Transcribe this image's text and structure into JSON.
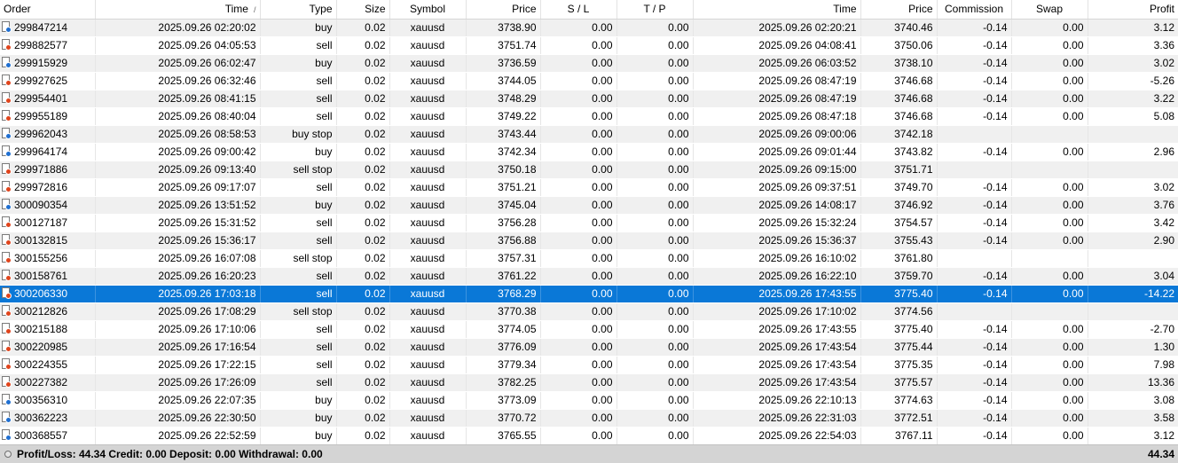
{
  "columns": [
    "Order",
    "Time",
    "Type",
    "Size",
    "Symbol",
    "Price",
    "S / L",
    "T / P",
    "Time",
    "Price",
    "Commission",
    "Swap",
    "Profit"
  ],
  "sort_indicator": "/",
  "colors": {
    "buy": "#1f6fd1",
    "sell": "#e0441c",
    "selected": "#0a78d7"
  },
  "rows": [
    {
      "order": "299847214",
      "open_time": "2025.09.26 02:20:02",
      "type": "buy",
      "size": "0.02",
      "symbol": "xauusd",
      "open_price": "3738.90",
      "sl": "0.00",
      "tp": "0.00",
      "close_time": "2025.09.26 02:20:21",
      "close_price": "3740.46",
      "commission": "-0.14",
      "swap": "0.00",
      "profit": "3.12",
      "icon": "buy"
    },
    {
      "order": "299882577",
      "open_time": "2025.09.26 04:05:53",
      "type": "sell",
      "size": "0.02",
      "symbol": "xauusd",
      "open_price": "3751.74",
      "sl": "0.00",
      "tp": "0.00",
      "close_time": "2025.09.26 04:08:41",
      "close_price": "3750.06",
      "commission": "-0.14",
      "swap": "0.00",
      "profit": "3.36",
      "icon": "sell"
    },
    {
      "order": "299915929",
      "open_time": "2025.09.26 06:02:47",
      "type": "buy",
      "size": "0.02",
      "symbol": "xauusd",
      "open_price": "3736.59",
      "sl": "0.00",
      "tp": "0.00",
      "close_time": "2025.09.26 06:03:52",
      "close_price": "3738.10",
      "commission": "-0.14",
      "swap": "0.00",
      "profit": "3.02",
      "icon": "buy"
    },
    {
      "order": "299927625",
      "open_time": "2025.09.26 06:32:46",
      "type": "sell",
      "size": "0.02",
      "symbol": "xauusd",
      "open_price": "3744.05",
      "sl": "0.00",
      "tp": "0.00",
      "close_time": "2025.09.26 08:47:19",
      "close_price": "3746.68",
      "commission": "-0.14",
      "swap": "0.00",
      "profit": "-5.26",
      "icon": "sell"
    },
    {
      "order": "299954401",
      "open_time": "2025.09.26 08:41:15",
      "type": "sell",
      "size": "0.02",
      "symbol": "xauusd",
      "open_price": "3748.29",
      "sl": "0.00",
      "tp": "0.00",
      "close_time": "2025.09.26 08:47:19",
      "close_price": "3746.68",
      "commission": "-0.14",
      "swap": "0.00",
      "profit": "3.22",
      "icon": "sell"
    },
    {
      "order": "299955189",
      "open_time": "2025.09.26 08:40:04",
      "type": "sell",
      "size": "0.02",
      "symbol": "xauusd",
      "open_price": "3749.22",
      "sl": "0.00",
      "tp": "0.00",
      "close_time": "2025.09.26 08:47:18",
      "close_price": "3746.68",
      "commission": "-0.14",
      "swap": "0.00",
      "profit": "5.08",
      "icon": "sell"
    },
    {
      "order": "299962043",
      "open_time": "2025.09.26 08:58:53",
      "type": "buy stop",
      "size": "0.02",
      "symbol": "xauusd",
      "open_price": "3743.44",
      "sl": "0.00",
      "tp": "0.00",
      "close_time": "2025.09.26 09:00:06",
      "close_price": "3742.18",
      "commission": "",
      "swap": "",
      "profit": "",
      "icon": "buy"
    },
    {
      "order": "299964174",
      "open_time": "2025.09.26 09:00:42",
      "type": "buy",
      "size": "0.02",
      "symbol": "xauusd",
      "open_price": "3742.34",
      "sl": "0.00",
      "tp": "0.00",
      "close_time": "2025.09.26 09:01:44",
      "close_price": "3743.82",
      "commission": "-0.14",
      "swap": "0.00",
      "profit": "2.96",
      "icon": "buy"
    },
    {
      "order": "299971886",
      "open_time": "2025.09.26 09:13:40",
      "type": "sell stop",
      "size": "0.02",
      "symbol": "xauusd",
      "open_price": "3750.18",
      "sl": "0.00",
      "tp": "0.00",
      "close_time": "2025.09.26 09:15:00",
      "close_price": "3751.71",
      "commission": "",
      "swap": "",
      "profit": "",
      "icon": "sell"
    },
    {
      "order": "299972816",
      "open_time": "2025.09.26 09:17:07",
      "type": "sell",
      "size": "0.02",
      "symbol": "xauusd",
      "open_price": "3751.21",
      "sl": "0.00",
      "tp": "0.00",
      "close_time": "2025.09.26 09:37:51",
      "close_price": "3749.70",
      "commission": "-0.14",
      "swap": "0.00",
      "profit": "3.02",
      "icon": "sell"
    },
    {
      "order": "300090354",
      "open_time": "2025.09.26 13:51:52",
      "type": "buy",
      "size": "0.02",
      "symbol": "xauusd",
      "open_price": "3745.04",
      "sl": "0.00",
      "tp": "0.00",
      "close_time": "2025.09.26 14:08:17",
      "close_price": "3746.92",
      "commission": "-0.14",
      "swap": "0.00",
      "profit": "3.76",
      "icon": "buy"
    },
    {
      "order": "300127187",
      "open_time": "2025.09.26 15:31:52",
      "type": "sell",
      "size": "0.02",
      "symbol": "xauusd",
      "open_price": "3756.28",
      "sl": "0.00",
      "tp": "0.00",
      "close_time": "2025.09.26 15:32:24",
      "close_price": "3754.57",
      "commission": "-0.14",
      "swap": "0.00",
      "profit": "3.42",
      "icon": "sell"
    },
    {
      "order": "300132815",
      "open_time": "2025.09.26 15:36:17",
      "type": "sell",
      "size": "0.02",
      "symbol": "xauusd",
      "open_price": "3756.88",
      "sl": "0.00",
      "tp": "0.00",
      "close_time": "2025.09.26 15:36:37",
      "close_price": "3755.43",
      "commission": "-0.14",
      "swap": "0.00",
      "profit": "2.90",
      "icon": "sell"
    },
    {
      "order": "300155256",
      "open_time": "2025.09.26 16:07:08",
      "type": "sell stop",
      "size": "0.02",
      "symbol": "xauusd",
      "open_price": "3757.31",
      "sl": "0.00",
      "tp": "0.00",
      "close_time": "2025.09.26 16:10:02",
      "close_price": "3761.80",
      "commission": "",
      "swap": "",
      "profit": "",
      "icon": "sell"
    },
    {
      "order": "300158761",
      "open_time": "2025.09.26 16:20:23",
      "type": "sell",
      "size": "0.02",
      "symbol": "xauusd",
      "open_price": "3761.22",
      "sl": "0.00",
      "tp": "0.00",
      "close_time": "2025.09.26 16:22:10",
      "close_price": "3759.70",
      "commission": "-0.14",
      "swap": "0.00",
      "profit": "3.04",
      "icon": "sell"
    },
    {
      "order": "300206330",
      "open_time": "2025.09.26 17:03:18",
      "type": "sell",
      "size": "0.02",
      "symbol": "xauusd",
      "open_price": "3768.29",
      "sl": "0.00",
      "tp": "0.00",
      "close_time": "2025.09.26 17:43:55",
      "close_price": "3775.40",
      "commission": "-0.14",
      "swap": "0.00",
      "profit": "-14.22",
      "icon": "sell",
      "selected": true
    },
    {
      "order": "300212826",
      "open_time": "2025.09.26 17:08:29",
      "type": "sell stop",
      "size": "0.02",
      "symbol": "xauusd",
      "open_price": "3770.38",
      "sl": "0.00",
      "tp": "0.00",
      "close_time": "2025.09.26 17:10:02",
      "close_price": "3774.56",
      "commission": "",
      "swap": "",
      "profit": "",
      "icon": "sell"
    },
    {
      "order": "300215188",
      "open_time": "2025.09.26 17:10:06",
      "type": "sell",
      "size": "0.02",
      "symbol": "xauusd",
      "open_price": "3774.05",
      "sl": "0.00",
      "tp": "0.00",
      "close_time": "2025.09.26 17:43:55",
      "close_price": "3775.40",
      "commission": "-0.14",
      "swap": "0.00",
      "profit": "-2.70",
      "icon": "sell"
    },
    {
      "order": "300220985",
      "open_time": "2025.09.26 17:16:54",
      "type": "sell",
      "size": "0.02",
      "symbol": "xauusd",
      "open_price": "3776.09",
      "sl": "0.00",
      "tp": "0.00",
      "close_time": "2025.09.26 17:43:54",
      "close_price": "3775.44",
      "commission": "-0.14",
      "swap": "0.00",
      "profit": "1.30",
      "icon": "sell"
    },
    {
      "order": "300224355",
      "open_time": "2025.09.26 17:22:15",
      "type": "sell",
      "size": "0.02",
      "symbol": "xauusd",
      "open_price": "3779.34",
      "sl": "0.00",
      "tp": "0.00",
      "close_time": "2025.09.26 17:43:54",
      "close_price": "3775.35",
      "commission": "-0.14",
      "swap": "0.00",
      "profit": "7.98",
      "icon": "sell"
    },
    {
      "order": "300227382",
      "open_time": "2025.09.26 17:26:09",
      "type": "sell",
      "size": "0.02",
      "symbol": "xauusd",
      "open_price": "3782.25",
      "sl": "0.00",
      "tp": "0.00",
      "close_time": "2025.09.26 17:43:54",
      "close_price": "3775.57",
      "commission": "-0.14",
      "swap": "0.00",
      "profit": "13.36",
      "icon": "sell"
    },
    {
      "order": "300356310",
      "open_time": "2025.09.26 22:07:35",
      "type": "buy",
      "size": "0.02",
      "symbol": "xauusd",
      "open_price": "3773.09",
      "sl": "0.00",
      "tp": "0.00",
      "close_time": "2025.09.26 22:10:13",
      "close_price": "3774.63",
      "commission": "-0.14",
      "swap": "0.00",
      "profit": "3.08",
      "icon": "buy"
    },
    {
      "order": "300362223",
      "open_time": "2025.09.26 22:30:50",
      "type": "buy",
      "size": "0.02",
      "symbol": "xauusd",
      "open_price": "3770.72",
      "sl": "0.00",
      "tp": "0.00",
      "close_time": "2025.09.26 22:31:03",
      "close_price": "3772.51",
      "commission": "-0.14",
      "swap": "0.00",
      "profit": "3.58",
      "icon": "buy"
    },
    {
      "order": "300368557",
      "open_time": "2025.09.26 22:52:59",
      "type": "buy",
      "size": "0.02",
      "symbol": "xauusd",
      "open_price": "3765.55",
      "sl": "0.00",
      "tp": "0.00",
      "close_time": "2025.09.26 22:54:03",
      "close_price": "3767.11",
      "commission": "-0.14",
      "swap": "0.00",
      "profit": "3.12",
      "icon": "buy"
    }
  ],
  "footer": {
    "summary": "Profit/Loss: 44.34  Credit: 0.00  Deposit: 0.00  Withdrawal: 0.00",
    "total": "44.34"
  }
}
